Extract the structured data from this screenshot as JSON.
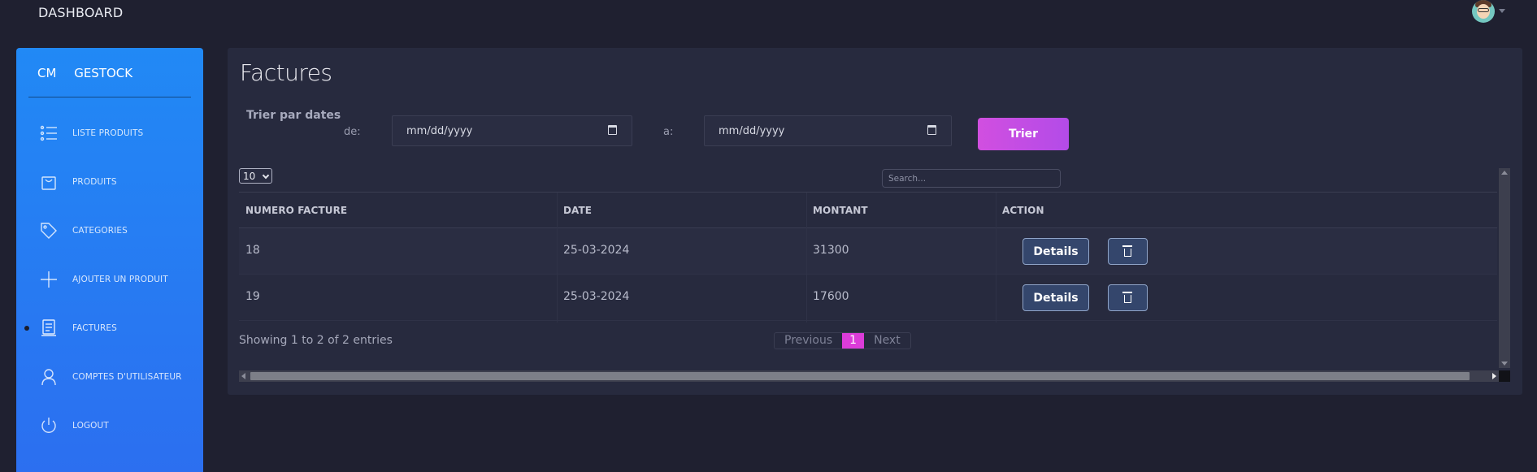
{
  "topbar": {
    "title": "DASHBOARD"
  },
  "sidebar": {
    "logo_mini": "CM",
    "logo_text": "GESTOCK",
    "items": [
      {
        "label": "LISTE PRODUITS",
        "icon": "list-icon"
      },
      {
        "label": "PRODUITS",
        "icon": "bag-icon"
      },
      {
        "label": "CATEGORIES",
        "icon": "tag-icon"
      },
      {
        "label": "AJOUTER UN PRODUIT",
        "icon": "plus-icon"
      },
      {
        "label": "FACTURES",
        "icon": "receipt-icon",
        "active": true
      },
      {
        "label": "COMPTES D'UTILISATEUR",
        "icon": "user-icon"
      },
      {
        "label": "LOGOUT",
        "icon": "power-icon"
      }
    ]
  },
  "main": {
    "title": "Factures",
    "filter": {
      "title": "Trier par dates",
      "from_label": "de:",
      "to_label": "a:",
      "from_placeholder": "mm/dd/yyyy",
      "to_placeholder": "mm/dd/yyyy",
      "button": "Trier"
    },
    "table": {
      "page_length": "10",
      "search_placeholder": "Search...",
      "columns": [
        "NUMERO FACTURE",
        "DATE",
        "MONTANT",
        "ACTION"
      ],
      "rows": [
        {
          "numero": "18",
          "date": "25-03-2024",
          "montant": "31300"
        },
        {
          "numero": "19",
          "date": "25-03-2024",
          "montant": "17600"
        }
      ],
      "details_label": "Details",
      "info": "Showing 1 to 2 of 2 entries",
      "pagination": {
        "previous": "Previous",
        "current": "1",
        "next": "Next"
      }
    }
  },
  "colors": {
    "background": "#1f2030",
    "card": "#272a3e",
    "sidebar_top": "#2189f5",
    "sidebar_bottom": "#2c6ef0",
    "accent": "#d14fe0",
    "button": "#34466c"
  }
}
